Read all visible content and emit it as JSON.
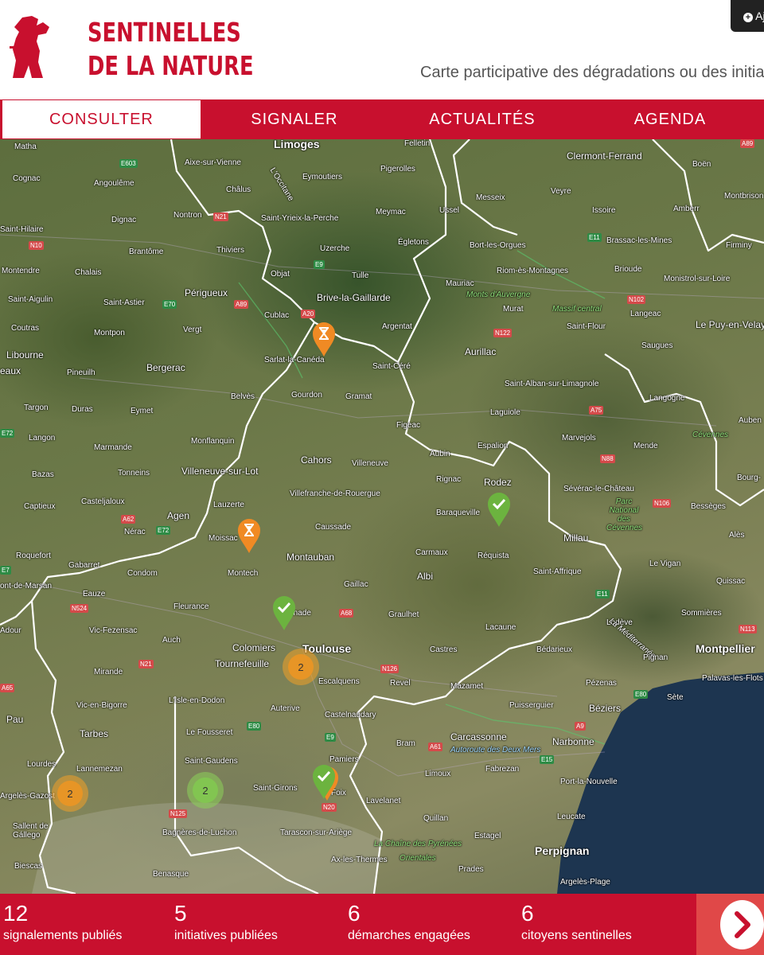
{
  "header": {
    "logo_line1": "SENTINELLES",
    "logo_line2": "DE LA NATURE",
    "tagline": "Carte participative des dégradations ou des initiatives",
    "add_button_label": "Ajouter"
  },
  "nav": {
    "items": [
      {
        "label": "CONSULTER",
        "active": true
      },
      {
        "label": "SIGNALER",
        "active": false
      },
      {
        "label": "ACTUALITÉS",
        "active": false
      },
      {
        "label": "AGENDA",
        "active": false
      }
    ]
  },
  "map": {
    "towns": {
      "matha": "Matha",
      "cognac": "Cognac",
      "angouleme": "Angoulême",
      "aixsurvienne": "Aixe-sur-Vienne",
      "limoges": "Limoges",
      "felletin": "Felletin",
      "clermont": "Clermont-Ferrand",
      "boen": "Boën",
      "chalus": "Châlus",
      "eymoutiers": "Eymoutiers",
      "pigerolles": "Pigerolles",
      "dignac": "Dignac",
      "nontron": "Nontron",
      "styrieix": "Saint-Yrieix-la-Perche",
      "meymac": "Meymac",
      "ussel": "Ussel",
      "messeix": "Messeix",
      "veyre": "Veyre",
      "issoire": "Issoire",
      "amberr": "Amberr",
      "montbrison": "Montbrison",
      "sthilaire": "Saint-Hilaire",
      "brantome": "Brantôme",
      "thiviers": "Thiviers",
      "uzerche": "Uzerche",
      "egletons": "Égletons",
      "portorgues": "Bort-les-Orgues",
      "brassac": "Brassac-les-Mines",
      "firminy": "Firminy",
      "montendre": "Montendre",
      "chalais": "Chalais",
      "objat": "Objat",
      "tulle": "Tulle",
      "riom": "Riom-ès-Montagnes",
      "brioude": "Brioude",
      "monistrol": "Monistrol-sur-Loire",
      "staigulin": "Saint-Aigulin",
      "stastier": "Saint-Astier",
      "perigueux": "Périgueux",
      "brive": "Brive-la-Gaillarde",
      "mauriac": "Mauriac",
      "montsdauvergne": "Monts d'Auvergne",
      "murat": "Murat",
      "massifcentral": "Massif central",
      "langeac": "Langeac",
      "coutras": "Coutras",
      "montpon": "Montpon",
      "vergt": "Vergt",
      "cublac": "Cublac",
      "argentat": "Argentat",
      "stflour": "Saint-Flour",
      "lepuy": "Le Puy-en-Velay",
      "libourne": "Libourne",
      "saugues": "Saugues",
      "aurillac": "Aurillac",
      "eaux": "eaux",
      "pineuilh": "Pineuilh",
      "bergerac": "Bergerac",
      "sarlat": "Sarlat-la-Canéda",
      "stcere": "Saint-Céré",
      "stalban": "Saint-Alban-sur-Limagnole",
      "belves": "Belvès",
      "gourdon": "Gourdon",
      "gramat": "Gramat",
      "langogne": "Langogne",
      "aubenas": "Auben",
      "targon": "Targon",
      "duras": "Duras",
      "eymet": "Eymet",
      "laguiole": "Laguiole",
      "figeac": "Figeac",
      "marvejols": "Marvejols",
      "langon": "Langon",
      "marmande": "Marmande",
      "monflanquin": "Monflanquin",
      "espalion": "Espalion",
      "mende": "Mende",
      "cevennes": "Cévennes",
      "cahors": "Cahors",
      "villeneuve": "Villeneuve",
      "aubin": "Aubin",
      "bazas": "Bazas",
      "tonneins": "Tonneins",
      "villeneuvesurlot": "Villeneuve-sur-Lot",
      "rignac": "Rignac",
      "rodez": "Rodez",
      "severac": "Sévérac-le-Château",
      "bourg": "Bourg-",
      "captieux": "Captieux",
      "casteljaloux": "Casteljaloux",
      "lauzerte": "Lauzerte",
      "villefranche": "Villefranche-de-Rouergue",
      "baraqueville": "Baraqueville",
      "parcnational": "Parc National des Cévennes",
      "besseges": "Bessèges",
      "agen": "Agen",
      "nerac": "Nérac",
      "caussade": "Caussade",
      "ales": "Alès",
      "millau": "Millau",
      "roquefort": "Roquefort",
      "moissac": "Moissac",
      "carmaux": "Carmaux",
      "requista": "Réquista",
      "gabarret": "Gabarret",
      "condom": "Condom",
      "montech": "Montech",
      "montauban": "Montauban",
      "albi": "Albi",
      "staffrique": "Saint-Affrique",
      "levigan": "Le Vigan",
      "montdemarsan": "ont-de-Marsan",
      "eauze": "Eauze",
      "gaillac": "Gaillac",
      "quissac": "Quissac",
      "fleurance": "Fleurance",
      "grenade": "Grenade",
      "graulhet": "Graulhet",
      "lacaune": "Lacaune",
      "lodeve": "Lodève",
      "sommieres": "Sommières",
      "adour": "Adour",
      "vicfezensac": "Vic-Fezensac",
      "auch": "Auch",
      "colomiers": "Colomiers",
      "toulouse": "Toulouse",
      "castres": "Castres",
      "bedarieux": "Bédarieux",
      "lamediterranee": "La Méditerranée",
      "pignan": "Pignan",
      "montpellier": "Montpellier",
      "mirande": "Mirande",
      "tournefeuille": "Tournefeuille",
      "escalquens": "Escalquens",
      "revel": "Revel",
      "mazamet": "Mazamet",
      "pezenas": "Pézenas",
      "palavas": "Palavas-les-Flots",
      "vicenbigorre": "Vic-en-Bigorre",
      "lisleendodon": "L'Isle-en-Dodon",
      "auterive": "Auterive",
      "puisserguier": "Puisserguier",
      "beziers": "Béziers",
      "sete": "Sète",
      "pau": "Pau",
      "tarbes": "Tarbes",
      "lefousseret": "Le Fousseret",
      "castelnaudary": "Castelnaudary",
      "carcassonne": "Carcassonne",
      "narbonne": "Narbonne",
      "bram": "Bram",
      "autoroutedeuxmers": "Autoroute des Deux Mers",
      "lourdes": "Lourdes",
      "lannemezan": "Lannemezan",
      "stgaudens": "Saint-Gaudens",
      "pamiers": "Pamiers",
      "limoux": "Limoux",
      "fabrezan": "Fabrezan",
      "portlanouvelle": "Port-la-Nouvelle",
      "argelesgazost": "Argelès-Gazost",
      "stgirons": "Saint-Girons",
      "foix": "Foix",
      "lavelanet": "Lavelanet",
      "quillan": "Quillan",
      "leucate": "Leucate",
      "sallentdegallego": "Sallent de Gállego",
      "bagneres": "Bagnères-de-Luchon",
      "tarascon": "Tarascon-sur-Ariège",
      "chainepyrenees": "La Chaîne des Pyrénées",
      "estagel": "Estagel",
      "perpignan": "Perpignan",
      "axlesthermes": "Ax-les-Thermes",
      "orientales": "Orientales",
      "biescas": "Biescas",
      "benasque": "Benasque",
      "prades": "Prades",
      "argelesplage": "Argelès-Plage",
      "loccitane": "L'Occitane"
    },
    "roads": {
      "e603": "E603",
      "a89a": "A89",
      "n21a": "N21",
      "n10": "N10",
      "e9a": "E9",
      "e11a": "E11",
      "e70": "E70",
      "a89b": "A89",
      "a20": "A20",
      "n102": "N102",
      "n122": "N122",
      "a75": "A75",
      "e72a": "E72",
      "n88": "N88",
      "a62": "A62",
      "e72b": "E72",
      "n106": "N106",
      "e7": "E7",
      "n524": "N524",
      "a68": "A68",
      "e11b": "E11",
      "n21b": "N21",
      "n126": "N126",
      "n113": "N113",
      "a65": "A65",
      "e80a": "E80",
      "e80b": "E80",
      "e9b": "E9",
      "a61": "A61",
      "e15": "E15",
      "a9": "A9",
      "n125": "N125",
      "n20": "N20"
    },
    "clusters": [
      {
        "count": "2",
        "color": "orange"
      },
      {
        "count": "2",
        "color": "orange"
      },
      {
        "count": "2",
        "color": "green"
      }
    ],
    "marker_colors": {
      "pending": "#f08a24",
      "done": "#6cb33f"
    }
  },
  "stats": {
    "items": [
      {
        "value": "12",
        "label": "signalements publiés"
      },
      {
        "value": "5",
        "label": "initiatives publiées"
      },
      {
        "value": "6",
        "label": "démarches engagées"
      },
      {
        "value": "6",
        "label": "citoyens sentinelles"
      }
    ]
  },
  "colors": {
    "brand": "#c8102e",
    "brand_light": "#e04848"
  }
}
